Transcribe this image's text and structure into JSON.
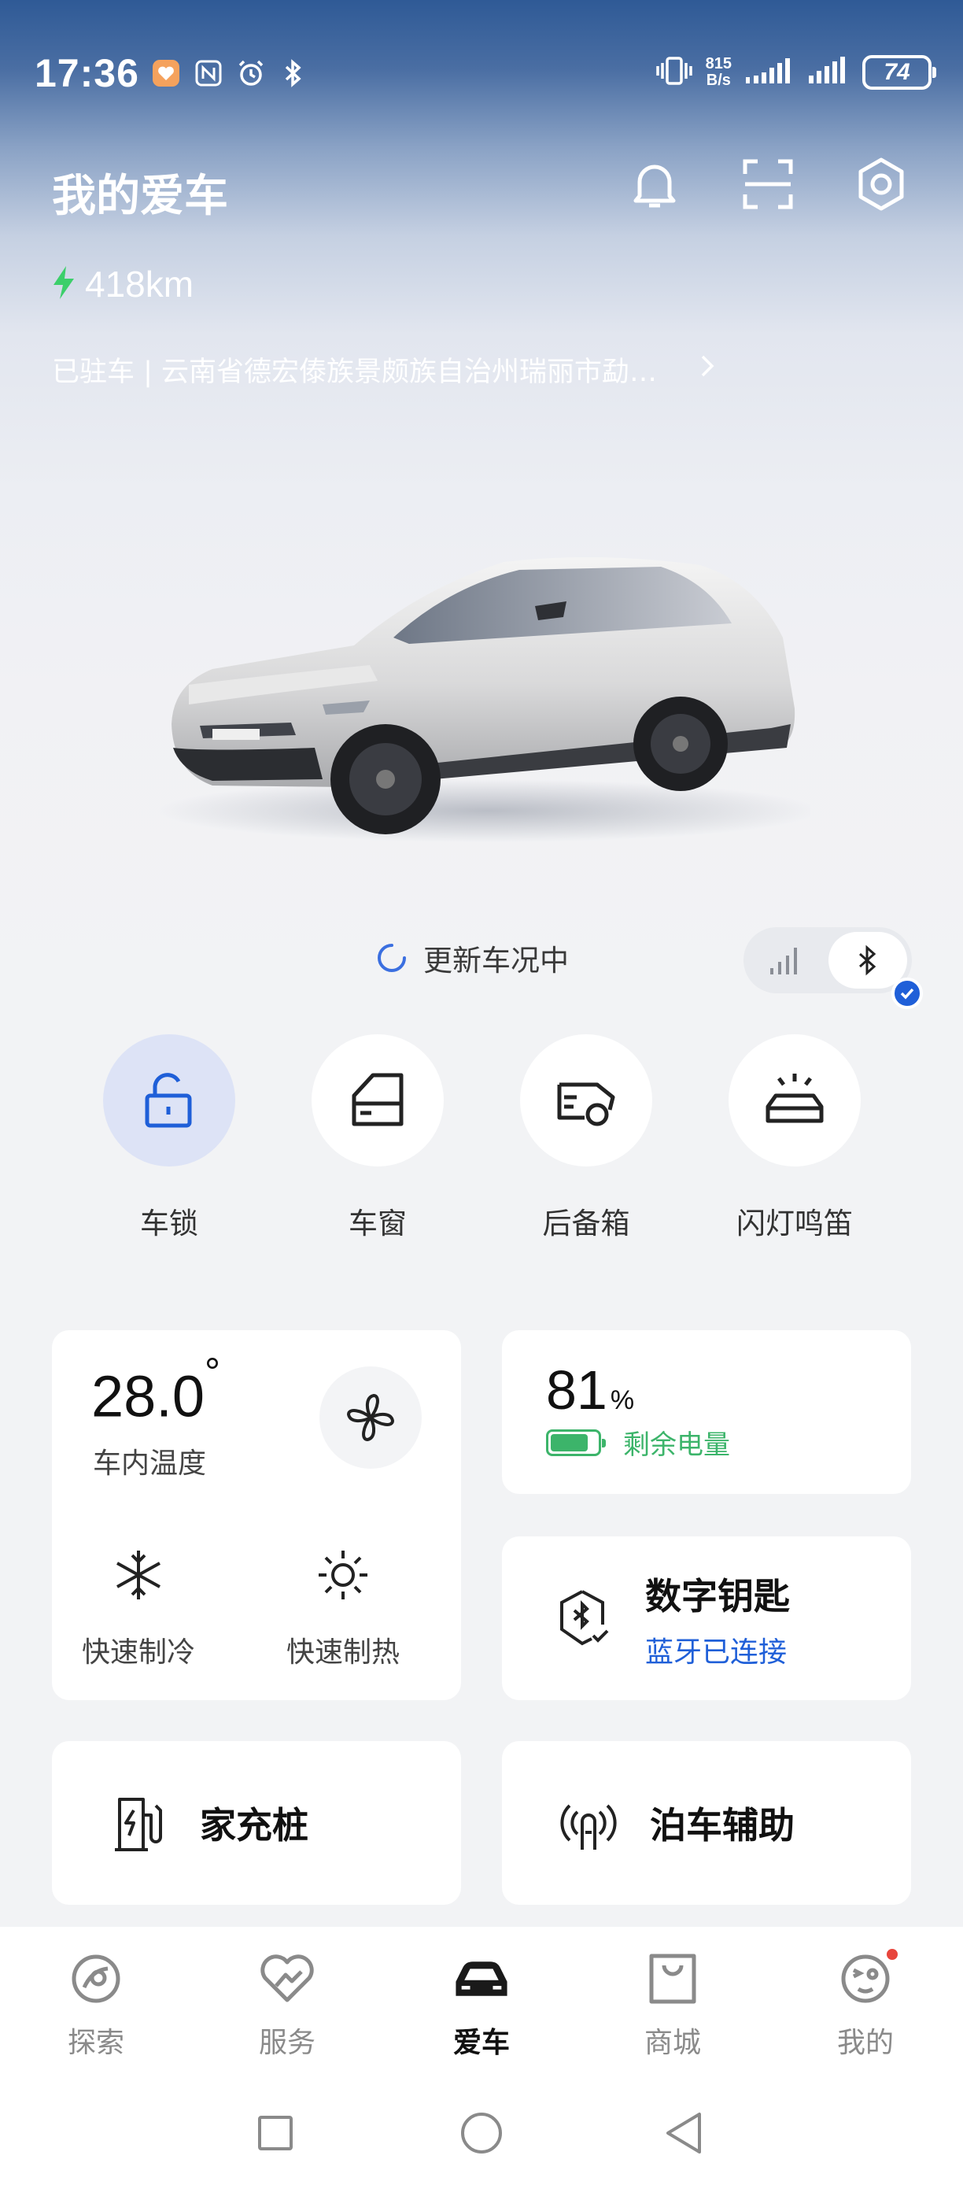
{
  "status_bar": {
    "time": "17:36",
    "net_speed_value": "815",
    "net_speed_unit": "B/s",
    "battery": "74"
  },
  "header": {
    "title": "我的爱车",
    "range": "418km",
    "location": "已驻车 | 云南省德宏傣族景颇族自治州瑞丽市勐…"
  },
  "car_status": {
    "updating_text": "更新车况中"
  },
  "quick_controls": [
    {
      "label": "车锁",
      "icon": "unlock-icon"
    },
    {
      "label": "车窗",
      "icon": "car-window-icon"
    },
    {
      "label": "后备箱",
      "icon": "trunk-icon"
    },
    {
      "label": "闪灯鸣笛",
      "icon": "flash-horn-icon"
    }
  ],
  "climate": {
    "temperature": "28.0",
    "degree": "°",
    "label": "车内温度",
    "cool_label": "快速制冷",
    "heat_label": "快速制热"
  },
  "battery_card": {
    "percent": "81",
    "unit": "%",
    "percent_value": 81,
    "label": "剩余电量",
    "color": "#3cb46a"
  },
  "digital_key": {
    "title": "数字钥匙",
    "status": "蓝牙已连接",
    "status_color": "#1f5fd8"
  },
  "home_charger": {
    "label": "家充桩"
  },
  "parking_assist": {
    "label": "泊车辅助"
  },
  "tabs": [
    {
      "label": "探索",
      "icon": "explore-icon"
    },
    {
      "label": "服务",
      "icon": "service-icon"
    },
    {
      "label": "爱车",
      "icon": "car-icon",
      "active": true
    },
    {
      "label": "商城",
      "icon": "shop-bag-icon"
    },
    {
      "label": "我的",
      "icon": "profile-icon",
      "badge": true
    }
  ]
}
